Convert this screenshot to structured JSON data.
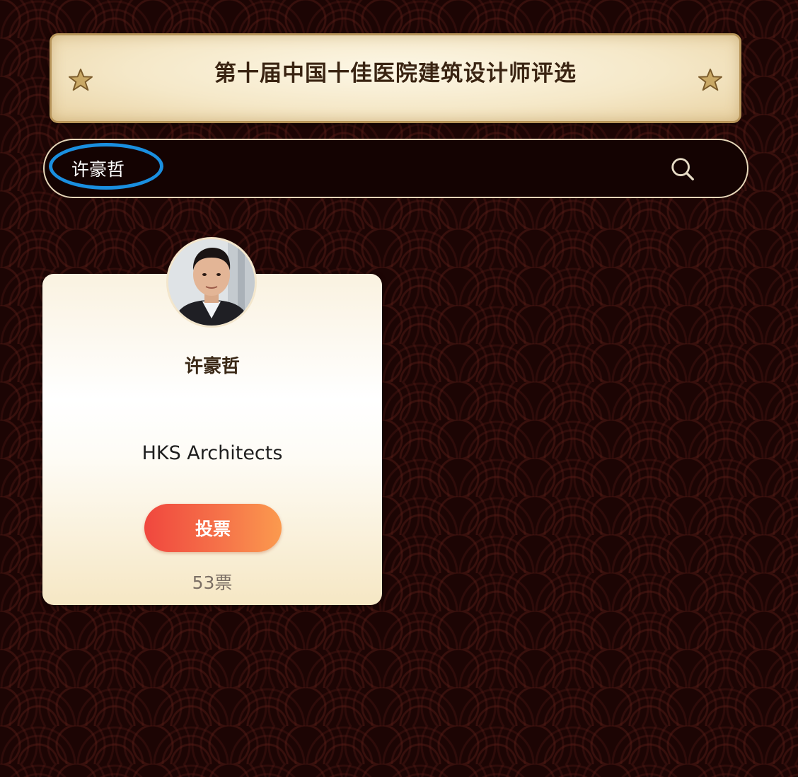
{
  "header": {
    "title": "第十届中国十佳医院建筑设计师评选"
  },
  "search": {
    "value": "许豪哲",
    "highlight_color": "#1a8fe0"
  },
  "candidate": {
    "name": "许豪哲",
    "company": "HKS Architects",
    "vote_label": "投票",
    "vote_count": "53票",
    "avatar_icon": "person-portrait"
  },
  "colors": {
    "background": "#1c0504",
    "banner": "#f5e8c8",
    "vote_button_start": "#f0473e",
    "vote_button_end": "#fb9a4e"
  }
}
